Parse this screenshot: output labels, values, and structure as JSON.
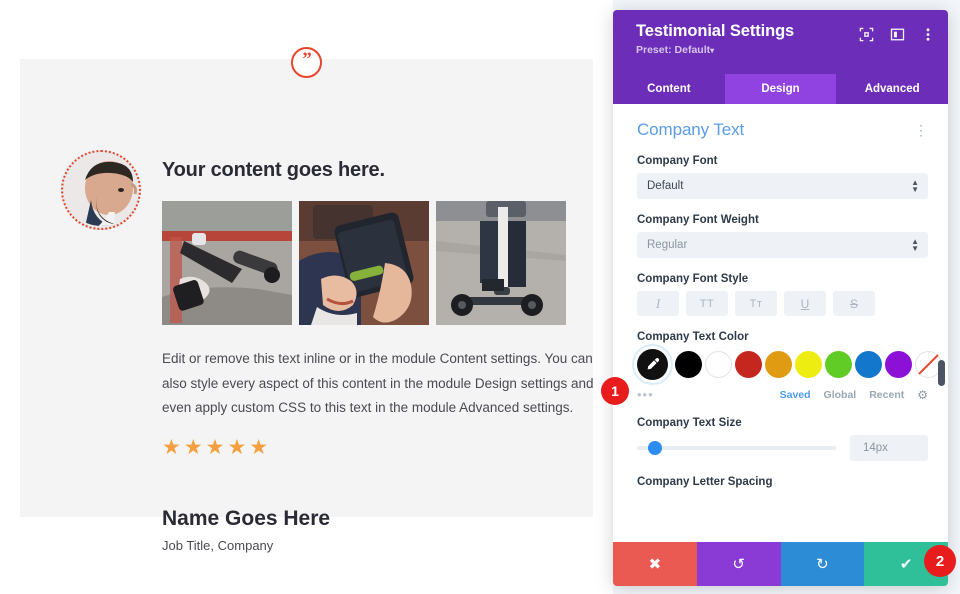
{
  "preview": {
    "quote_icon": "quote-mark-icon",
    "title": "Your content goes here.",
    "gallery": [
      {
        "alt": "scooter-handlebar-photo"
      },
      {
        "alt": "hands-holding-phone-photo"
      },
      {
        "alt": "person-riding-scooter-photo"
      }
    ],
    "body": "Edit or remove this text inline or in the module Content settings. You can also style every aspect of this content in the module Design settings and even apply custom CSS to this text in the module Advanced settings.",
    "stars": "★★★★★",
    "star_count": 5,
    "name": "Name Goes Here",
    "job": "Job Title, Company",
    "avatar_alt": "person-portrait-avatar"
  },
  "panel": {
    "title": "Testimonial Settings",
    "preset": "Preset: Default",
    "preset_caret": "▾",
    "header_icons": [
      {
        "name": "fullscreen-icon"
      },
      {
        "name": "layout-view-icon"
      },
      {
        "name": "more-vertical-icon"
      }
    ],
    "tabs": [
      {
        "label": "Content",
        "active": false
      },
      {
        "label": "Design",
        "active": true
      },
      {
        "label": "Advanced",
        "active": false
      }
    ],
    "section": {
      "title": "Company Text",
      "kebab": "⋮"
    },
    "fields": {
      "company_font": {
        "label": "Company Font",
        "value": "Default"
      },
      "company_font_weight": {
        "label": "Company Font Weight",
        "value": "Regular"
      },
      "company_font_style": {
        "label": "Company Font Style",
        "buttons": [
          {
            "glyph": "I",
            "name": "italic-button"
          },
          {
            "glyph": "TT",
            "name": "uppercase-button"
          },
          {
            "glyph": "Tт",
            "name": "small-caps-button"
          },
          {
            "glyph": "U",
            "name": "underline-button"
          },
          {
            "glyph": "S",
            "name": "strikethrough-button"
          }
        ]
      },
      "company_text_color": {
        "label": "Company Text Color",
        "swatches": [
          {
            "name": "color-picker-eyedropper",
            "hex": "#111111",
            "kind": "picker"
          },
          {
            "name": "swatch-black",
            "hex": "#000000",
            "kind": "solid"
          },
          {
            "name": "swatch-white",
            "hex": "#ffffff",
            "kind": "white"
          },
          {
            "name": "swatch-red",
            "hex": "#c5271f",
            "kind": "solid"
          },
          {
            "name": "swatch-orange",
            "hex": "#e09b12",
            "kind": "solid"
          },
          {
            "name": "swatch-yellow",
            "hex": "#eded12",
            "kind": "solid"
          },
          {
            "name": "swatch-green",
            "hex": "#62cc26",
            "kind": "solid"
          },
          {
            "name": "swatch-blue",
            "hex": "#1377cc",
            "kind": "solid"
          },
          {
            "name": "swatch-purple",
            "hex": "#8c10d6",
            "kind": "solid"
          },
          {
            "name": "swatch-none",
            "hex": "#ffffff",
            "kind": "none"
          }
        ],
        "more_dots": "•••",
        "tabs": [
          {
            "label": "Saved",
            "active": true
          },
          {
            "label": "Global",
            "active": false
          },
          {
            "label": "Recent",
            "active": false
          }
        ],
        "gear": "⚙"
      },
      "company_text_size": {
        "label": "Company Text Size",
        "value": "14px",
        "slider_percent": 9
      },
      "company_letter_spacing": {
        "label": "Company Letter Spacing"
      }
    },
    "footer": [
      {
        "name": "close-button",
        "glyph": "✖",
        "color": "#eb5a52"
      },
      {
        "name": "undo-button",
        "glyph": "↺",
        "color": "#8a3bd6"
      },
      {
        "name": "redo-button",
        "glyph": "↻",
        "color": "#2d8cd6"
      },
      {
        "name": "save-button",
        "glyph": "✔",
        "color": "#2fc09a"
      }
    ]
  },
  "badges": {
    "one": "1",
    "two": "2"
  }
}
